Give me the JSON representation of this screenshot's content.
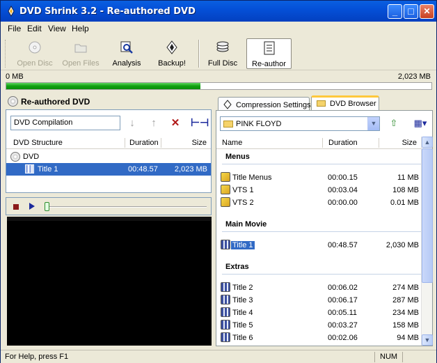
{
  "window": {
    "title": "DVD Shrink 3.2 - Re-authored DVD",
    "minimize": "_",
    "maximize": "□",
    "close": "✕"
  },
  "menu": [
    "File",
    "Edit",
    "View",
    "Help"
  ],
  "toolbar": {
    "open_disc": "Open Disc",
    "open_files": "Open Files",
    "analysis": "Analysis",
    "backup": "Backup!",
    "full_disc": "Full Disc",
    "re_author": "Re-author"
  },
  "size_bar": {
    "left_label": "0 MB",
    "right_label": "2,023 MB",
    "fill_fraction": 0.456
  },
  "left_panel": {
    "title": "Re-authored DVD",
    "compilation_name": "DVD Compilation",
    "columns": [
      "DVD Structure",
      "Duration",
      "Size"
    ],
    "tree": {
      "root": "DVD",
      "items": [
        {
          "name": "Title 1",
          "duration": "00:48.57",
          "size": "2,023 MB"
        }
      ]
    }
  },
  "tabs": {
    "compression": "Compression Settings",
    "browser": "DVD Browser"
  },
  "browser": {
    "path": "PINK FLOYD",
    "columns": [
      "Name",
      "Duration",
      "Size"
    ],
    "sections": {
      "menus": "Menus",
      "main_movie": "Main Movie",
      "extras": "Extras"
    },
    "menus": [
      {
        "name": "Title Menus",
        "duration": "00:00.15",
        "size": "11 MB"
      },
      {
        "name": "VTS 1",
        "duration": "00:03.04",
        "size": "108 MB"
      },
      {
        "name": "VTS 2",
        "duration": "00:00.00",
        "size": "0.01 MB"
      }
    ],
    "main_movie": [
      {
        "name": "Title 1",
        "duration": "00:48.57",
        "size": "2,030 MB"
      }
    ],
    "extras": [
      {
        "name": "Title 2",
        "duration": "00:06.02",
        "size": "274 MB"
      },
      {
        "name": "Title 3",
        "duration": "00:06.17",
        "size": "287 MB"
      },
      {
        "name": "Title 4",
        "duration": "00:05.11",
        "size": "234 MB"
      },
      {
        "name": "Title 5",
        "duration": "00:03.27",
        "size": "158 MB"
      },
      {
        "name": "Title 6",
        "duration": "00:02.06",
        "size": "94 MB"
      }
    ]
  },
  "status": {
    "help": "For Help, press F1",
    "num": "NUM"
  }
}
